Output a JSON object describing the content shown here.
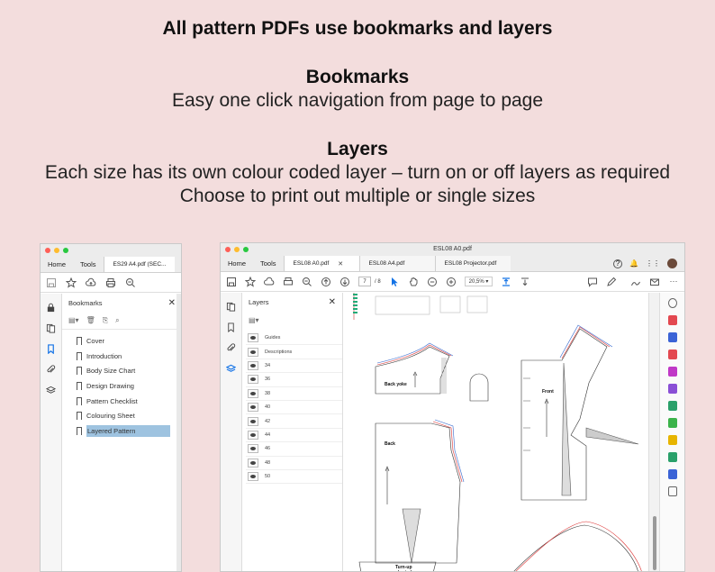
{
  "headline": "All pattern PDFs use bookmarks and layers",
  "bookmarks_section": {
    "title": "Bookmarks",
    "subtitle": "Easy one click navigation from page to page"
  },
  "layers_section": {
    "title": "Layers",
    "line1": "Each size has its own colour coded layer – turn on or off layers as required",
    "line2": "Choose to print out multiple or single sizes"
  },
  "window1": {
    "nav_tabs": [
      "Home",
      "Tools"
    ],
    "doc_tab": "ES29 A4.pdf (SEC...",
    "panel_title": "Bookmarks",
    "bookmarks": [
      {
        "label": "Cover"
      },
      {
        "label": "Introduction"
      },
      {
        "label": "Body Size Chart"
      },
      {
        "label": "Design Drawing"
      },
      {
        "label": "Pattern Checklist"
      },
      {
        "label": "Colouring Sheet"
      },
      {
        "label": "Layered Pattern",
        "selected": true
      }
    ]
  },
  "window2": {
    "title": "ESL08 A0.pdf",
    "nav_tabs": [
      "Home",
      "Tools"
    ],
    "doc_tabs": [
      {
        "label": "ESL08 A0.pdf",
        "active": true
      },
      {
        "label": "ESL08 A4.pdf",
        "active": false
      },
      {
        "label": "ESL08 Projector.pdf",
        "active": false
      }
    ],
    "page_current": "7",
    "page_total": "/ 8",
    "zoom": "20,5%",
    "panel_title": "Layers",
    "layers": [
      "Guides",
      "Descriptions",
      "34",
      "36",
      "38",
      "40",
      "42",
      "44",
      "46",
      "48",
      "50"
    ],
    "pieces": {
      "back_yoke": "Back yoke",
      "front": "Front",
      "back": "Back",
      "turn_up": "Turn-up short sleeve"
    }
  },
  "colors": {
    "background": "#f3dddd",
    "selection": "#9ec3e0",
    "acrobat_blue": "#1473e6"
  }
}
